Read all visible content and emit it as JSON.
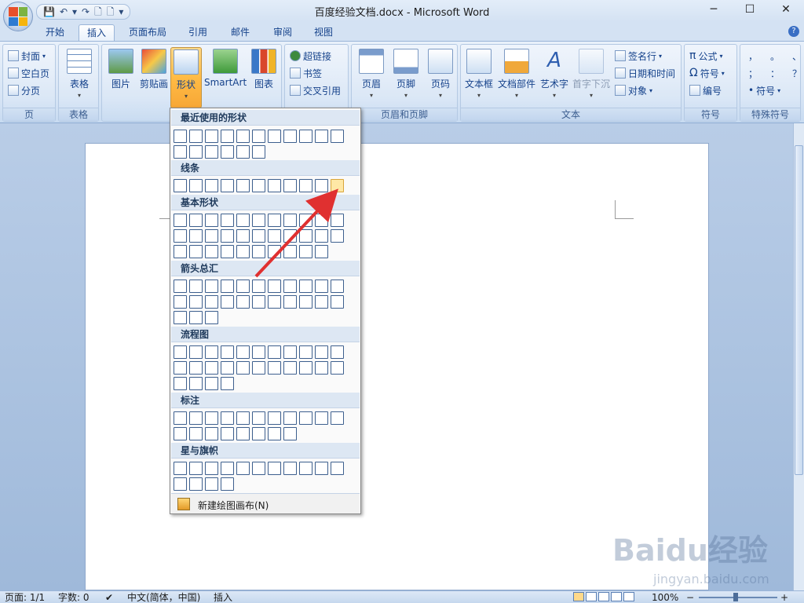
{
  "window": {
    "title": "百度经验文档.docx - Microsoft Word",
    "controls": {
      "minimize": "─",
      "maximize": "☐",
      "close": "✕"
    },
    "help": "?"
  },
  "qat": {
    "save": "💾",
    "undo": "↶",
    "undo_arrow": "▾",
    "redo": "↷",
    "new": "🗋",
    "open": "🗋",
    "more": "▾"
  },
  "tabs": [
    "开始",
    "插入",
    "页面布局",
    "引用",
    "邮件",
    "审阅",
    "视图"
  ],
  "active_tab": "插入",
  "ribbon": {
    "page_group": {
      "label": "页",
      "items": [
        "封面",
        "空白页",
        "分页"
      ]
    },
    "table_group": {
      "label": "表格",
      "button": "表格"
    },
    "illustrations": {
      "picture": "图片",
      "clipart": "剪贴画",
      "shapes": "形状",
      "smartart": "SmartArt",
      "chart": "图表"
    },
    "links_group": {
      "items": [
        "超链接",
        "书签",
        "交叉引用"
      ]
    },
    "header_footer": {
      "label": "页眉和页脚",
      "header": "页眉",
      "footer": "页脚",
      "page_number": "页码"
    },
    "text_group": {
      "label": "文本",
      "textbox": "文本框",
      "quickparts": "文档部件",
      "wordart": "艺术字",
      "dropcap": "首字下沉",
      "signature": "签名行",
      "datetime": "日期和时间",
      "object": "对象"
    },
    "symbols_group": {
      "label": "符号",
      "equation": "公式",
      "symbol": "符号",
      "number": "编号"
    },
    "special_group": {
      "label": "特殊符号",
      "chars": [
        "，",
        "。",
        "、",
        "；",
        "：",
        "？"
      ],
      "symbol": "符号"
    }
  },
  "shapes_menu": {
    "recent": "最近使用的形状",
    "lines": "线条",
    "basic": "基本形状",
    "arrows": "箭头总汇",
    "flowchart": "流程图",
    "callouts": "标注",
    "stars": "星与旗帜",
    "new_canvas": "新建绘图画布(N)"
  },
  "statusbar": {
    "page": "页面: 1/1",
    "words": "字数: 0",
    "language": "中文(简体，中国)",
    "mode": "插入",
    "zoom": "100%",
    "zoom_minus": "−",
    "zoom_plus": "+"
  },
  "watermark": {
    "brand": "Baidu经验",
    "url": "jingyan.baidu.com"
  },
  "colors": {
    "accent": "#15428b",
    "arrow": "#e03030",
    "pressed": "#ffbb45"
  }
}
